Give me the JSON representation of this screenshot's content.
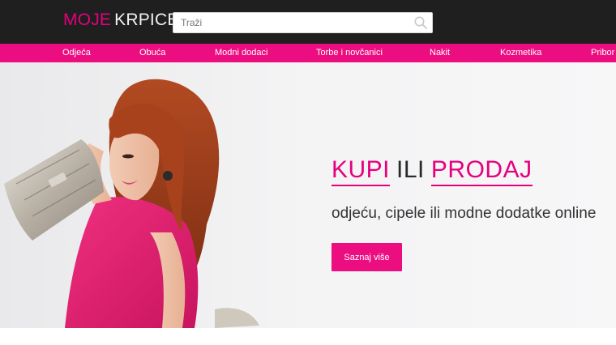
{
  "header": {
    "logo_part1": "MOJE",
    "logo_part2": "KRPICE",
    "search_placeholder": "Traži"
  },
  "nav": {
    "items": [
      "Odjeća",
      "Obuća",
      "Modni dodaci",
      "Torbe i novčanici",
      "Nakit",
      "Kozmetika",
      "Pribor z"
    ]
  },
  "hero": {
    "word1": "KUPI",
    "word2": "ILI",
    "word3": "PRODAJ",
    "subtitle": "odjeću, cipele ili modne dodatke online",
    "button_label": "Saznaj više"
  },
  "colors": {
    "accent": "#e6007e",
    "nav_bg": "#ec0e80",
    "topbar_bg": "#1f1f1f"
  },
  "icons": [
    "search-icon"
  ]
}
